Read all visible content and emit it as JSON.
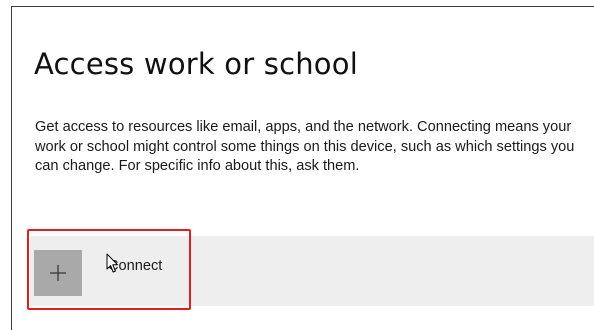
{
  "page": {
    "title": "Access work or school",
    "description": "Get access to resources like email, apps, and the network. Connecting means your work or school might control some things on this device, such as which settings you can change. For specific info about this, ask them."
  },
  "connect": {
    "label": "Connect",
    "icon": "plus-icon"
  },
  "annotation": {
    "highlight_color": "#e02020"
  },
  "colors": {
    "row_background": "#eeeeee",
    "button_background": "#a9a9a9"
  }
}
